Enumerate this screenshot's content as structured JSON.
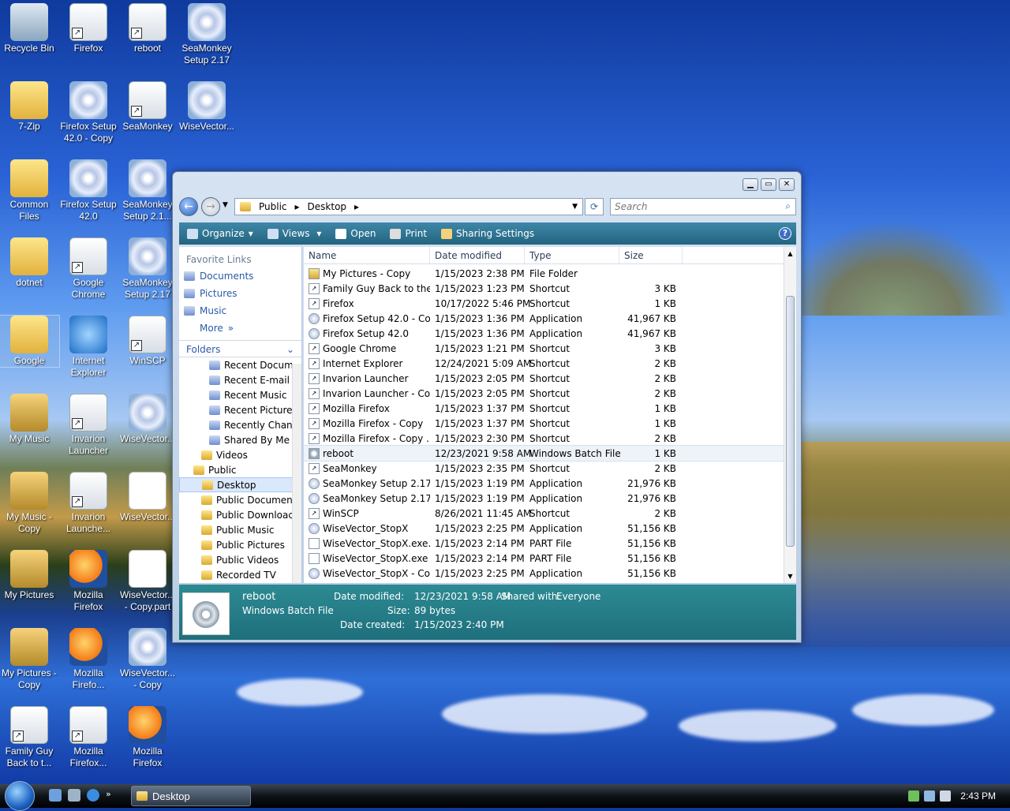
{
  "desktop": {
    "icons": [
      {
        "label": "Recycle Bin",
        "kind": "bin"
      },
      {
        "label": "Firefox",
        "kind": "short"
      },
      {
        "label": "reboot",
        "kind": "short"
      },
      {
        "label": "SeaMonkey Setup 2.17",
        "kind": "cd"
      },
      {
        "label": "7-Zip",
        "kind": "folder"
      },
      {
        "label": "Firefox Setup 42.0 - Copy",
        "kind": "cd"
      },
      {
        "label": "SeaMonkey",
        "kind": "short"
      },
      {
        "label": "WiseVector...",
        "kind": "cd"
      },
      {
        "label": "Common Files",
        "kind": "folder"
      },
      {
        "label": "Firefox Setup 42.0",
        "kind": "cd"
      },
      {
        "label": "SeaMonkey Setup 2.1...",
        "kind": "cd"
      },
      {
        "label": "dotnet",
        "kind": "folder"
      },
      {
        "label": "Google Chrome",
        "kind": "short"
      },
      {
        "label": "SeaMonkey Setup 2.17",
        "kind": "cd"
      },
      {
        "label": "Google",
        "kind": "folder"
      },
      {
        "label": "Internet Explorer",
        "kind": "ie"
      },
      {
        "label": "WinSCP",
        "kind": "short"
      },
      {
        "label": "My Music",
        "kind": "pic"
      },
      {
        "label": "Invarion Launcher",
        "kind": "short"
      },
      {
        "label": "WiseVector...",
        "kind": "cd"
      },
      {
        "label": "My Music - Copy",
        "kind": "pic"
      },
      {
        "label": "Invarion Launche...",
        "kind": "short"
      },
      {
        "label": "WiseVector...",
        "kind": "doc"
      },
      {
        "label": "My Pictures",
        "kind": "pic"
      },
      {
        "label": "Mozilla Firefox",
        "kind": "ff"
      },
      {
        "label": "WiseVector... - Copy.part",
        "kind": "doc"
      },
      {
        "label": "My Pictures - Copy",
        "kind": "pic"
      },
      {
        "label": "Mozilla Firefo...",
        "kind": "ff"
      },
      {
        "label": "WiseVector... - Copy",
        "kind": "cd"
      },
      {
        "label": "Family Guy Back to t...",
        "kind": "short"
      },
      {
        "label": "Mozilla Firefox...",
        "kind": "short"
      },
      {
        "label": "Mozilla Firefox",
        "kind": "ff"
      }
    ]
  },
  "window": {
    "breadcrumb": [
      "Public",
      "Desktop"
    ],
    "search_placeholder": "Search",
    "toolbar": {
      "organize": "Organize",
      "views": "Views",
      "open": "Open",
      "print": "Print",
      "sharing": "Sharing Settings",
      "help": "?"
    },
    "favorite_links_header": "Favorite Links",
    "favorite_links": [
      "Documents",
      "Pictures",
      "Music"
    ],
    "more": "More",
    "folders_header": "Folders",
    "tree": [
      {
        "label": "Recent Docum",
        "indent": 38,
        "blue": true
      },
      {
        "label": "Recent E-mail",
        "indent": 38,
        "blue": true
      },
      {
        "label": "Recent Music",
        "indent": 38,
        "blue": true
      },
      {
        "label": "Recent Picture",
        "indent": 38,
        "blue": true
      },
      {
        "label": "Recently Chan",
        "indent": 38,
        "blue": true
      },
      {
        "label": "Shared By Me",
        "indent": 38,
        "blue": true
      },
      {
        "label": "Videos",
        "indent": 28,
        "blue": false
      },
      {
        "label": "Public",
        "indent": 18,
        "blue": false
      },
      {
        "label": "Desktop",
        "indent": 28,
        "blue": false,
        "selected": true
      },
      {
        "label": "Public Documen",
        "indent": 28,
        "blue": false
      },
      {
        "label": "Public Downloac",
        "indent": 28,
        "blue": false
      },
      {
        "label": "Public Music",
        "indent": 28,
        "blue": false
      },
      {
        "label": "Public Pictures",
        "indent": 28,
        "blue": false
      },
      {
        "label": "Public Videos",
        "indent": 28,
        "blue": false
      },
      {
        "label": "Recorded TV",
        "indent": 28,
        "blue": false
      }
    ],
    "columns": [
      "Name",
      "Date modified",
      "Type",
      "Size"
    ],
    "files": [
      {
        "name": "My Pictures - Copy",
        "date": "1/15/2023 2:38 PM",
        "type": "File Folder",
        "size": ""
      },
      {
        "name": "Family Guy Back to the...",
        "date": "1/15/2023 1:23 PM",
        "type": "Shortcut",
        "size": "3 KB"
      },
      {
        "name": "Firefox",
        "date": "10/17/2022 5:46 PM",
        "type": "Shortcut",
        "size": "1 KB"
      },
      {
        "name": "Firefox Setup 42.0 - Co...",
        "date": "1/15/2023 1:36 PM",
        "type": "Application",
        "size": "41,967 KB"
      },
      {
        "name": "Firefox Setup 42.0",
        "date": "1/15/2023 1:36 PM",
        "type": "Application",
        "size": "41,967 KB"
      },
      {
        "name": "Google Chrome",
        "date": "1/15/2023 1:21 PM",
        "type": "Shortcut",
        "size": "3 KB"
      },
      {
        "name": "Internet Explorer",
        "date": "12/24/2021 5:09 AM",
        "type": "Shortcut",
        "size": "2 KB"
      },
      {
        "name": "Invarion Launcher",
        "date": "1/15/2023 2:05 PM",
        "type": "Shortcut",
        "size": "2 KB"
      },
      {
        "name": "Invarion Launcher - Co...",
        "date": "1/15/2023 2:05 PM",
        "type": "Shortcut",
        "size": "2 KB"
      },
      {
        "name": "Mozilla Firefox",
        "date": "1/15/2023 1:37 PM",
        "type": "Shortcut",
        "size": "1 KB"
      },
      {
        "name": "Mozilla Firefox - Copy",
        "date": "1/15/2023 1:37 PM",
        "type": "Shortcut",
        "size": "1 KB"
      },
      {
        "name": "Mozilla Firefox - Copy ...",
        "date": "1/15/2023 2:30 PM",
        "type": "Shortcut",
        "size": "2 KB"
      },
      {
        "name": "reboot",
        "date": "12/23/2021 9:58 AM",
        "type": "Windows Batch File",
        "size": "1 KB",
        "selected": true
      },
      {
        "name": "SeaMonkey",
        "date": "1/15/2023 2:35 PM",
        "type": "Shortcut",
        "size": "2 KB"
      },
      {
        "name": "SeaMonkey Setup 2.17 ...",
        "date": "1/15/2023 1:19 PM",
        "type": "Application",
        "size": "21,976 KB"
      },
      {
        "name": "SeaMonkey Setup 2.17",
        "date": "1/15/2023 1:19 PM",
        "type": "Application",
        "size": "21,976 KB"
      },
      {
        "name": "WinSCP",
        "date": "8/26/2021 11:45 AM",
        "type": "Shortcut",
        "size": "2 KB"
      },
      {
        "name": "WiseVector_StopX",
        "date": "1/15/2023 2:25 PM",
        "type": "Application",
        "size": "51,156 KB"
      },
      {
        "name": "WiseVector_StopX.exe....",
        "date": "1/15/2023 2:14 PM",
        "type": "PART File",
        "size": "51,156 KB"
      },
      {
        "name": "WiseVector_StopX.exe ...",
        "date": "1/15/2023 2:14 PM",
        "type": "PART File",
        "size": "51,156 KB"
      },
      {
        "name": "WiseVector_StopX - Co...",
        "date": "1/15/2023 2:25 PM",
        "type": "Application",
        "size": "51,156 KB"
      }
    ],
    "details": {
      "name": "reboot",
      "type": "Windows Batch File",
      "date_modified_label": "Date modified:",
      "date_modified": "12/23/2021 9:58 AM",
      "size_label": "Size:",
      "size": "89 bytes",
      "date_created_label": "Date created:",
      "date_created": "1/15/2023 2:40 PM",
      "shared_label": "Shared with:",
      "shared": "Everyone"
    }
  },
  "taskbar": {
    "task_label": "Desktop",
    "clock": "2:43 PM"
  }
}
